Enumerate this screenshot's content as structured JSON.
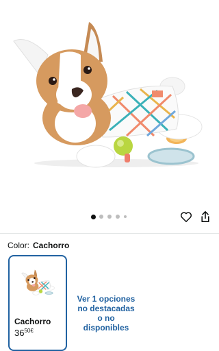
{
  "product": {
    "image_icon": "corgi-plush-activity-toy",
    "carousel": {
      "total": 5,
      "active": 0
    }
  },
  "actions": {
    "wishlist_icon": "heart-icon",
    "share_icon": "share-icon"
  },
  "variant": {
    "color_label": "Color:",
    "color_value": "Cachorro",
    "options": [
      {
        "name": "Cachorro",
        "price_whole": "36",
        "price_fraction": "50",
        "currency": "€",
        "selected": true
      }
    ],
    "unavailable_link": "Ver 1 opciones no destacadas o no disponibles"
  },
  "colors": {
    "accent": "#2162a1",
    "text": "#0f1111",
    "divider": "#e3e6e6"
  }
}
